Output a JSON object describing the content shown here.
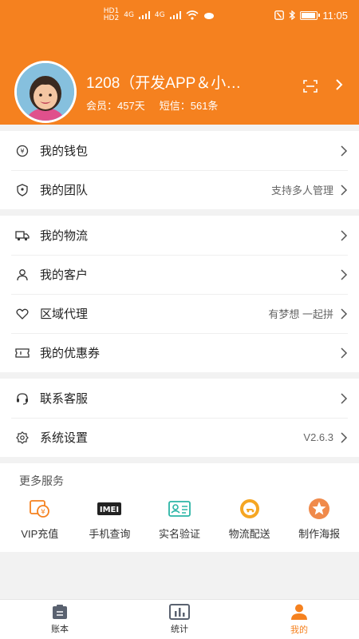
{
  "status_bar": {
    "carrier_left": "HD 1\nHD 2",
    "signal_1": "4G",
    "signal_2": "4G",
    "time": "11:05",
    "battery_level": 0.95
  },
  "profile": {
    "name": "1208（开发APP＆小…",
    "member_label": "会员：",
    "member_value": "457天",
    "sms_label": "短信：",
    "sms_value": "561条"
  },
  "menu_group_1": [
    {
      "label": "我的钱包",
      "hint": ""
    },
    {
      "label": "我的团队",
      "hint": "支持多人管理"
    }
  ],
  "menu_group_2": [
    {
      "label": "我的物流",
      "hint": ""
    },
    {
      "label": "我的客户",
      "hint": ""
    },
    {
      "label": "区域代理",
      "hint": "有梦想 一起拼"
    },
    {
      "label": "我的优惠券",
      "hint": ""
    }
  ],
  "menu_group_3": [
    {
      "label": "联系客服",
      "hint": ""
    },
    {
      "label": "系统设置",
      "hint": "V2.6.3"
    }
  ],
  "more_services": {
    "title": "更多服务",
    "items": [
      {
        "label": "VIP充值",
        "icon": "vip-recharge-icon"
      },
      {
        "label": "手机查询",
        "icon": "imei-icon",
        "icon_text": "IMEI"
      },
      {
        "label": "实名验证",
        "icon": "id-card-icon"
      },
      {
        "label": "物流配送",
        "icon": "delivery-icon"
      },
      {
        "label": "制作海报",
        "icon": "poster-star-icon"
      }
    ]
  },
  "tabbar": [
    {
      "label": "账本",
      "active": false
    },
    {
      "label": "统计",
      "active": false
    },
    {
      "label": "我的",
      "active": true
    }
  ],
  "colors": {
    "brand": "#f5811f",
    "teal": "#2bb5a6",
    "background": "#f2f2f2"
  }
}
